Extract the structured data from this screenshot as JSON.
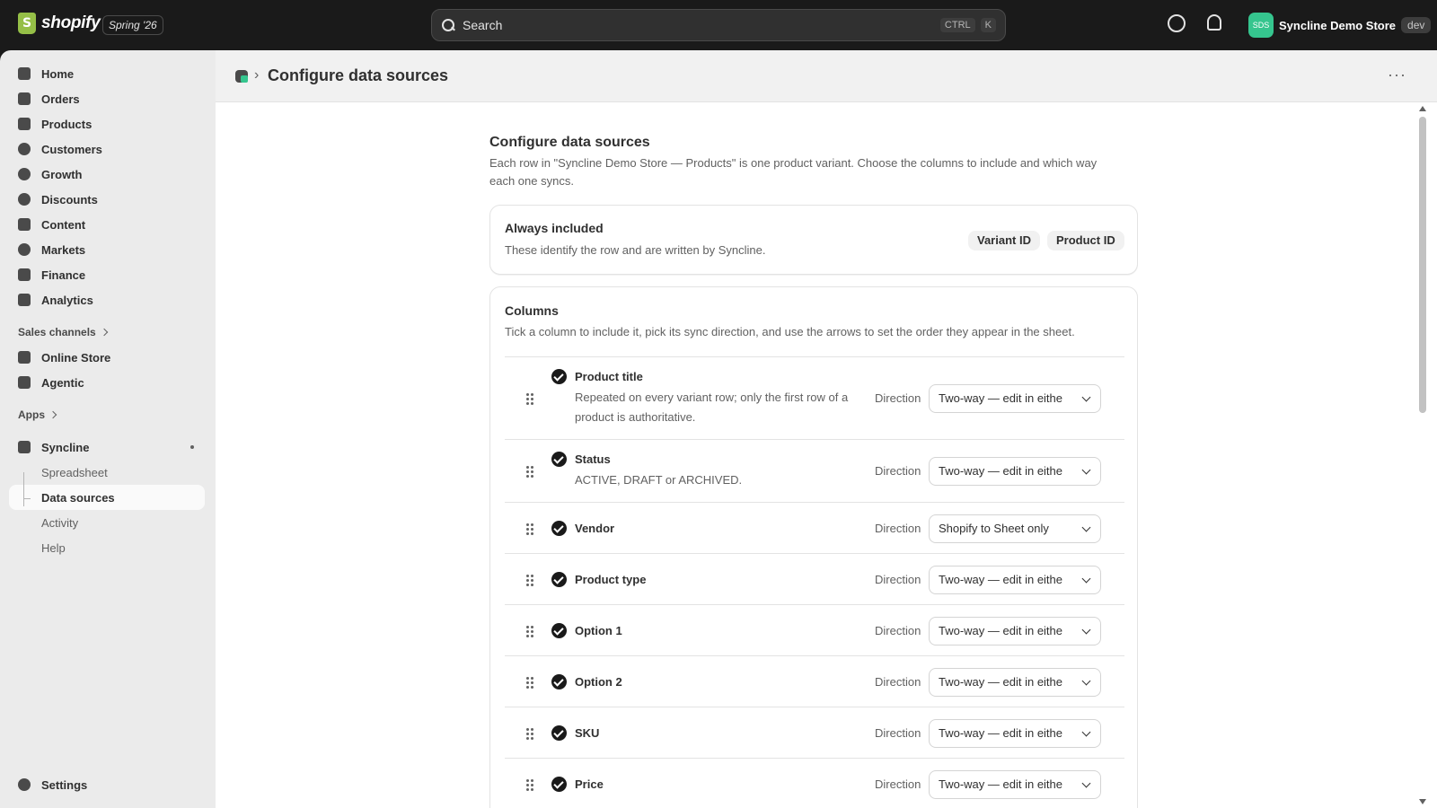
{
  "topbar": {
    "brand": "shopify",
    "edition": "Spring '26",
    "search_label": "Search",
    "search_shortcut_1": "CTRL",
    "search_shortcut_2": "K",
    "store_avatar": "SDS",
    "store_name": "Syncline Demo Store",
    "store_badge": "dev"
  },
  "sidebar": {
    "items": [
      {
        "label": "Home",
        "icon": "home-icon"
      },
      {
        "label": "Orders",
        "icon": "orders-icon"
      },
      {
        "label": "Products",
        "icon": "tag-icon"
      },
      {
        "label": "Customers",
        "icon": "person-icon"
      },
      {
        "label": "Growth",
        "icon": "growth-icon"
      },
      {
        "label": "Discounts",
        "icon": "discount-icon"
      },
      {
        "label": "Content",
        "icon": "content-icon"
      },
      {
        "label": "Markets",
        "icon": "globe-icon"
      },
      {
        "label": "Finance",
        "icon": "bank-icon"
      },
      {
        "label": "Analytics",
        "icon": "bar-chart-icon"
      }
    ],
    "sales_channels_label": "Sales channels",
    "channels": [
      {
        "label": "Online Store",
        "icon": "store-icon"
      },
      {
        "label": "Agentic",
        "icon": "agent-icon"
      }
    ],
    "apps_label": "Apps",
    "app_name": "Syncline",
    "app_subitems": [
      "Spreadsheet",
      "Data sources",
      "Activity",
      "Help"
    ],
    "settings_label": "Settings"
  },
  "page": {
    "breadcrumb_title": "Configure data sources",
    "heading": "Configure data sources",
    "intro": "Each row in \"Syncline Demo Store — Products\" is one product variant. Choose the columns to include and which way each one syncs."
  },
  "always_included": {
    "title": "Always included",
    "subtitle": "These identify the row and are written by Syncline.",
    "pills": [
      "Variant ID",
      "Product ID"
    ]
  },
  "columns": {
    "title": "Columns",
    "subtitle": "Tick a column to include it, pick its sync direction, and use the arrows to set the order they appear in the sheet.",
    "direction_label": "Direction",
    "rows": [
      {
        "name": "Product title",
        "desc": "Repeated on every variant row; only the first row of a product is authoritative.",
        "direction": "Two-way — edit in eithe"
      },
      {
        "name": "Status",
        "desc": "ACTIVE, DRAFT or ARCHIVED.",
        "direction": "Two-way — edit in eithe"
      },
      {
        "name": "Vendor",
        "desc": "",
        "direction": "Shopify to Sheet only"
      },
      {
        "name": "Product type",
        "desc": "",
        "direction": "Two-way — edit in eithe"
      },
      {
        "name": "Option 1",
        "desc": "",
        "direction": "Two-way — edit in eithe"
      },
      {
        "name": "Option 2",
        "desc": "",
        "direction": "Two-way — edit in eithe"
      },
      {
        "name": "SKU",
        "desc": "",
        "direction": "Two-way — edit in eithe"
      },
      {
        "name": "Price",
        "desc": "",
        "direction": "Two-way — edit in eithe"
      }
    ]
  },
  "colors": {
    "accent_green": "#35c58e",
    "topbar_bg": "#1a1a1a",
    "sidebar_bg": "#ebebeb"
  }
}
